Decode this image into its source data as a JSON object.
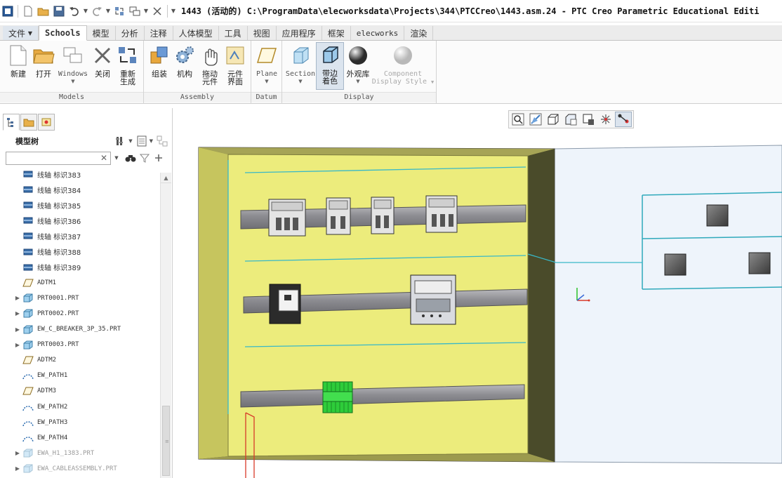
{
  "title_bar": {
    "title": "1443 (活动的) C:\\ProgramData\\elecworksdata\\Projects\\344\\PTCCreo\\1443.asm.24 - PTC Creo Parametric Educational Editi",
    "quick_access": [
      "app-icon",
      "new-icon",
      "open-icon",
      "save-icon",
      "undo-icon",
      "redo-icon",
      "regenerate-icon",
      "windows-icon",
      "close-window-icon",
      "customize-icon"
    ]
  },
  "tabs": [
    {
      "label": "文件"
    },
    {
      "label": "Schools"
    },
    {
      "label": "模型"
    },
    {
      "label": "分析"
    },
    {
      "label": "注释"
    },
    {
      "label": "人体模型"
    },
    {
      "label": "工具"
    },
    {
      "label": "视图"
    },
    {
      "label": "应用程序"
    },
    {
      "label": "框架"
    },
    {
      "label": "elecworks"
    },
    {
      "label": "渲染"
    }
  ],
  "ribbon": {
    "groups": [
      {
        "label": "Models"
      },
      {
        "label": "Assembly"
      },
      {
        "label": "Datum"
      },
      {
        "label": "Display"
      }
    ],
    "buttons": {
      "new": "新建",
      "open": "打开",
      "windows": "Windows",
      "close": "关闭",
      "regenerate_1": "重新",
      "regenerate_2": "生成",
      "assemble": "组装",
      "mechanism": "机构",
      "drag_1": "拖动",
      "drag_2": "元件",
      "component_interface_1": "元件",
      "component_interface_2": "界面",
      "plane": "Plane",
      "section": "Section",
      "shading_1": "带边",
      "shading_2": "着色",
      "appearance": "外观库",
      "component_display_1": "Component",
      "component_display_2": "Display Style"
    }
  },
  "model_tree": {
    "header": "模型树",
    "search_value": "",
    "items": [
      {
        "label": "线轴 标识383",
        "icon": "spool-icon",
        "expandable": false,
        "grey": false,
        "mono": false
      },
      {
        "label": "线轴 标识384",
        "icon": "spool-icon",
        "expandable": false,
        "grey": false,
        "mono": false
      },
      {
        "label": "线轴 标识385",
        "icon": "spool-icon",
        "expandable": false,
        "grey": false,
        "mono": false
      },
      {
        "label": "线轴 标识386",
        "icon": "spool-icon",
        "expandable": false,
        "grey": false,
        "mono": false
      },
      {
        "label": "线轴 标识387",
        "icon": "spool-icon",
        "expandable": false,
        "grey": false,
        "mono": false
      },
      {
        "label": "线轴 标识388",
        "icon": "spool-icon",
        "expandable": false,
        "grey": false,
        "mono": false
      },
      {
        "label": "线轴 标识389",
        "icon": "spool-icon",
        "expandable": false,
        "grey": false,
        "mono": false
      },
      {
        "label": "ADTM1",
        "icon": "datum-plane-icon",
        "expandable": false,
        "grey": false,
        "mono": true
      },
      {
        "label": "PRT0001.PRT",
        "icon": "part-icon",
        "expandable": true,
        "grey": false,
        "mono": true
      },
      {
        "label": "PRT0002.PRT",
        "icon": "part-icon",
        "expandable": true,
        "grey": false,
        "mono": true
      },
      {
        "label": "EW_C_BREAKER_3P_35.PRT",
        "icon": "part-icon",
        "expandable": true,
        "grey": false,
        "mono": true
      },
      {
        "label": "PRT0003.PRT",
        "icon": "part-icon",
        "expandable": true,
        "grey": false,
        "mono": true
      },
      {
        "label": "ADTM2",
        "icon": "datum-plane-icon",
        "expandable": false,
        "grey": false,
        "mono": true
      },
      {
        "label": "EW_PATH1",
        "icon": "path-icon",
        "expandable": false,
        "grey": false,
        "mono": true
      },
      {
        "label": "ADTM3",
        "icon": "datum-plane-icon",
        "expandable": false,
        "grey": false,
        "mono": true
      },
      {
        "label": "EW_PATH2",
        "icon": "path-icon",
        "expandable": false,
        "grey": false,
        "mono": true
      },
      {
        "label": "EW_PATH3",
        "icon": "path-icon",
        "expandable": false,
        "grey": false,
        "mono": true
      },
      {
        "label": "EW_PATH4",
        "icon": "path-icon",
        "expandable": false,
        "grey": false,
        "mono": true
      },
      {
        "label": "EWA_H1_1383.PRT",
        "icon": "part-icon",
        "expandable": true,
        "grey": true,
        "mono": true
      },
      {
        "label": "EWA_CABLEASSEMBLY.PRT",
        "icon": "part-icon",
        "expandable": true,
        "grey": true,
        "mono": true
      }
    ]
  },
  "view_toolbar": [
    "refit-icon",
    "zoom-in-icon",
    "view-orient-icon",
    "saved-views-icon",
    "display-style-icon",
    "datum-display-icon",
    "spin-center-icon"
  ],
  "colors": {
    "cabinet_face": "#ecec7c",
    "cabinet_frame": "#585a32",
    "door": "#eef4fb",
    "rail": "#8c8c90",
    "terminal": "#2ecc3a",
    "wire": "#38b8c8"
  }
}
